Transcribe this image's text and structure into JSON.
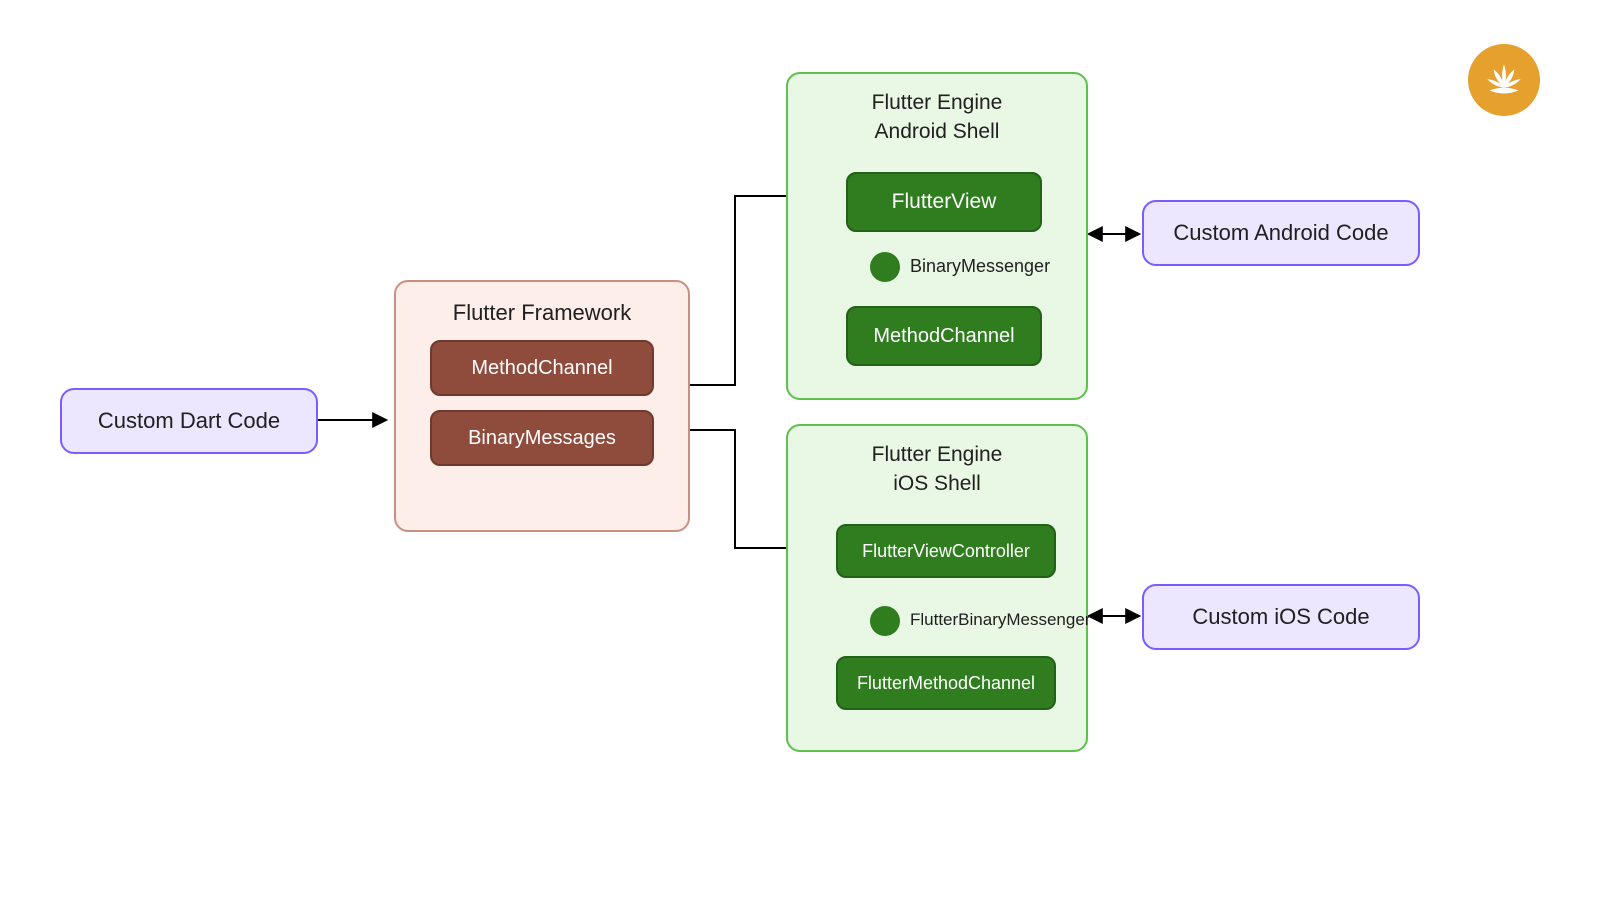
{
  "nodes": {
    "dart": {
      "label": "Custom Dart Code"
    },
    "android": {
      "label": "Custom Android Code"
    },
    "ios": {
      "label": "Custom iOS Code"
    }
  },
  "framework": {
    "title": "Flutter Framework",
    "method_channel": "MethodChannel",
    "binary_messages": "BinaryMessages"
  },
  "engine_android": {
    "title_line1": "Flutter Engine",
    "title_line2": "Android Shell",
    "flutter_view": "FlutterView",
    "binary_messenger": "BinaryMessenger",
    "method_channel": "MethodChannel"
  },
  "engine_ios": {
    "title_line1": "Flutter Engine",
    "title_line2": "iOS Shell",
    "flutter_view_controller": "FlutterViewController",
    "flutter_binary_messenger": "FlutterBinaryMessenger",
    "flutter_method_channel": "FlutterMethodChannel"
  },
  "logo": {
    "name": "lotus-logo"
  }
}
